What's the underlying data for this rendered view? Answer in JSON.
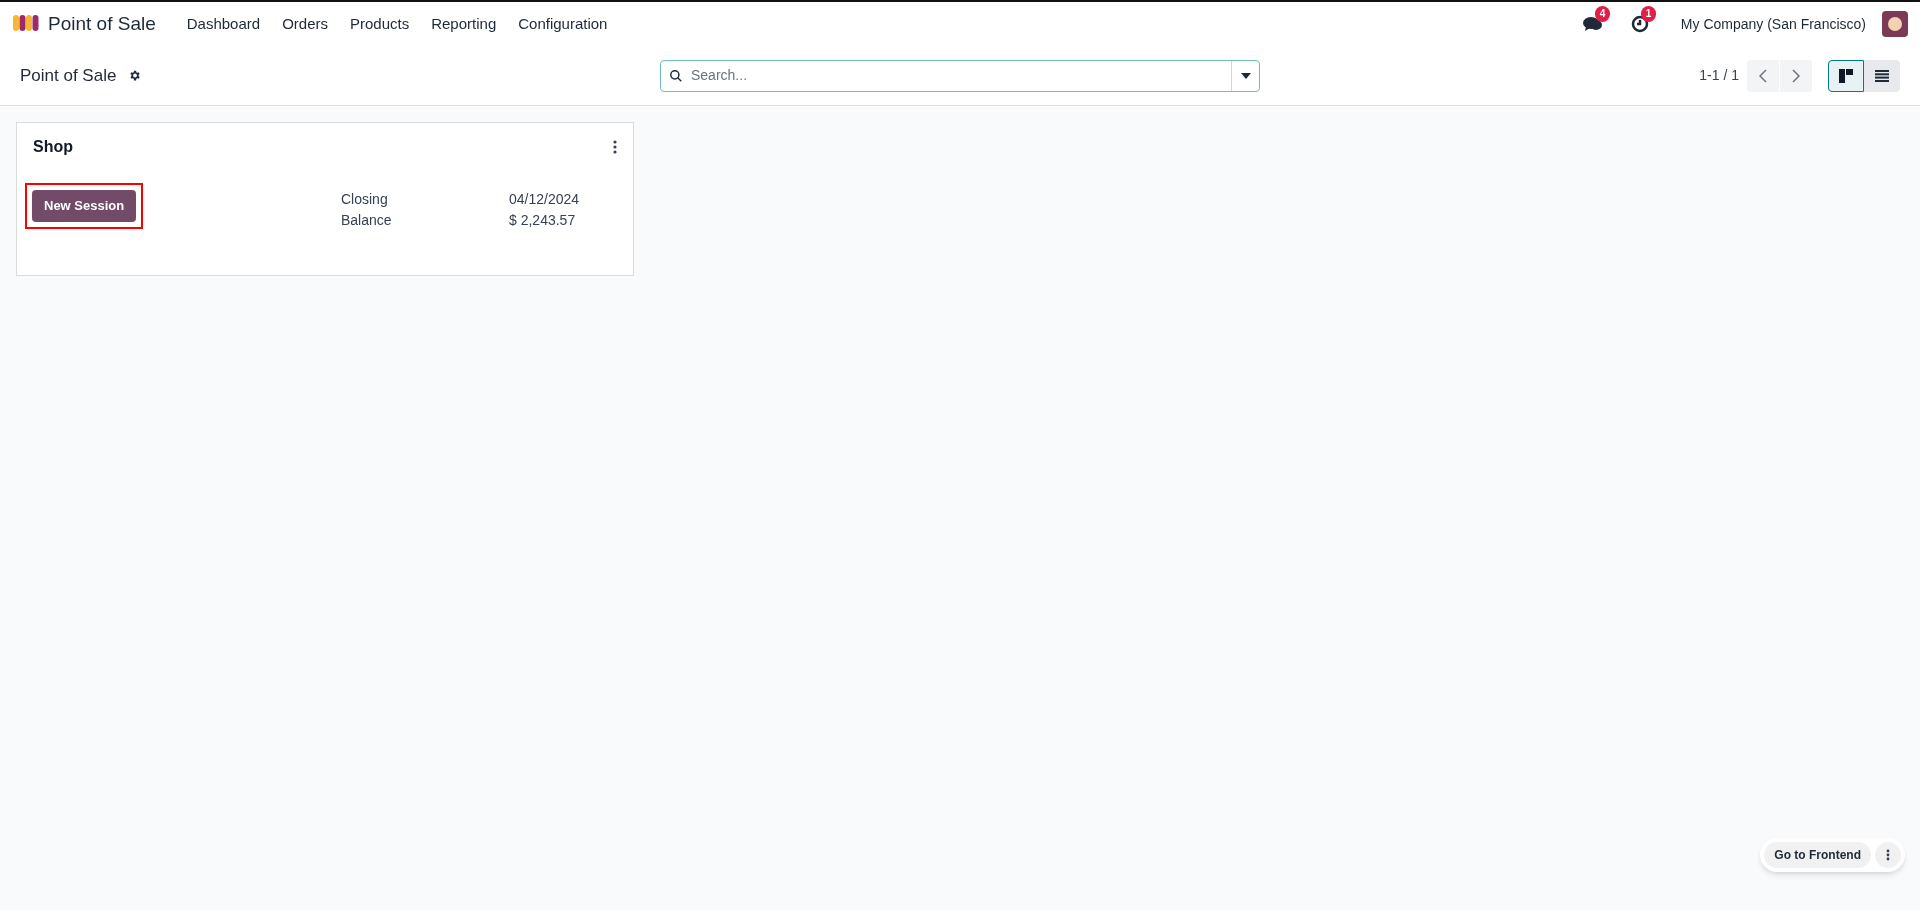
{
  "navbar": {
    "app_name": "Point of Sale",
    "menu": [
      "Dashboard",
      "Orders",
      "Products",
      "Reporting",
      "Configuration"
    ],
    "messages_badge": "4",
    "activities_badge": "1",
    "company": "My Company (San Francisco)"
  },
  "control_panel": {
    "title": "Point of Sale",
    "search": {
      "placeholder": "Search..."
    },
    "pager": "1-1 / 1",
    "views": [
      {
        "kind": "kanban",
        "selected": true
      },
      {
        "kind": "list",
        "selected": false
      }
    ]
  },
  "cards": [
    {
      "title": "Shop",
      "button": "New Session",
      "highlighted": true,
      "fields": [
        {
          "label": "Closing",
          "value": "04/12/2024"
        },
        {
          "label": "Balance",
          "value": "$ 2,243.57"
        }
      ]
    }
  ],
  "floating": {
    "button": "Go to Frontend"
  }
}
